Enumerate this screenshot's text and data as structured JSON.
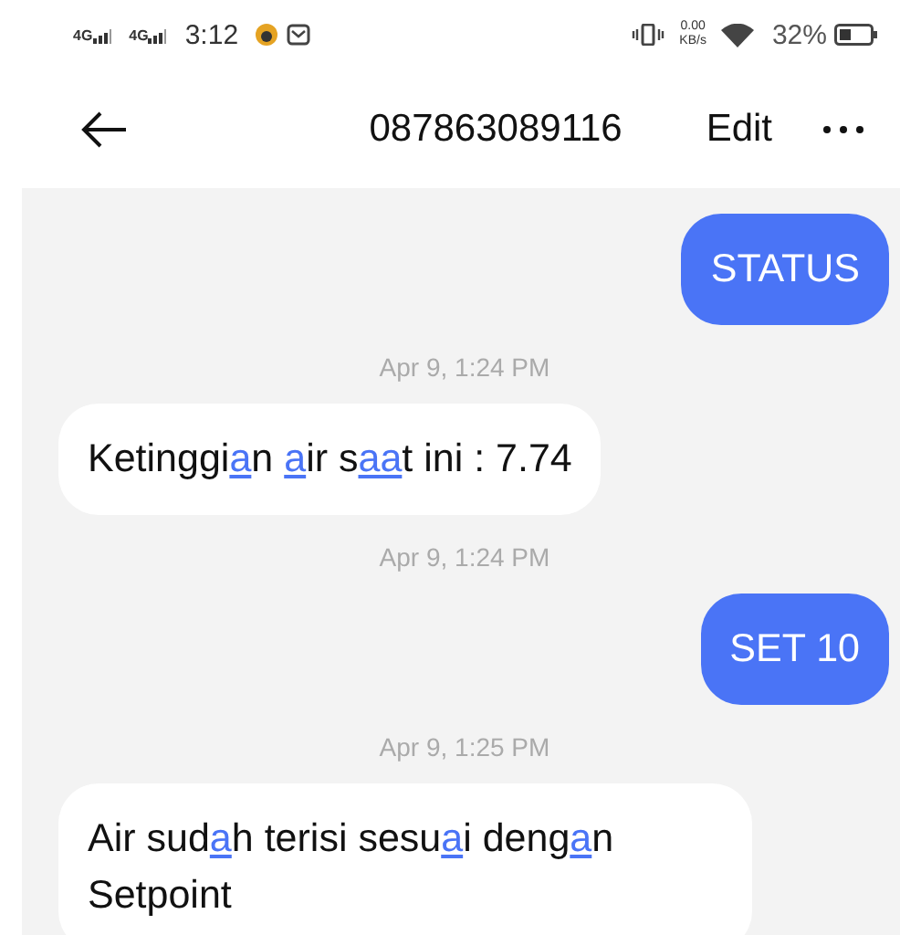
{
  "status_bar": {
    "networks": [
      "4G",
      "4G"
    ],
    "time": "3:12",
    "speed": "0.00",
    "speed_unit": "KB/s",
    "battery": "32%"
  },
  "header": {
    "title": "087863089116",
    "edit": "Edit"
  },
  "messages": [
    {
      "kind": "sent",
      "parts": [
        {
          "text": "STATUS",
          "underlined": false
        }
      ]
    },
    {
      "kind": "time",
      "text": "Apr 9, 1:24 PM"
    },
    {
      "kind": "received",
      "parts": [
        {
          "text": "Ketinggi",
          "underlined": false
        },
        {
          "text": "a",
          "underlined": true
        },
        {
          "text": "n ",
          "underlined": false
        },
        {
          "text": "a",
          "underlined": true
        },
        {
          "text": "ir s",
          "underlined": false
        },
        {
          "text": "aa",
          "underlined": true
        },
        {
          "text": "t ini : 7.74",
          "underlined": false
        }
      ]
    },
    {
      "kind": "time",
      "text": "Apr 9, 1:24 PM"
    },
    {
      "kind": "sent",
      "parts": [
        {
          "text": "SET 10",
          "underlined": false
        }
      ]
    },
    {
      "kind": "time",
      "text": "Apr 9, 1:25 PM"
    },
    {
      "kind": "received",
      "parts": [
        {
          "text": "Air sud",
          "underlined": false
        },
        {
          "text": "a",
          "underlined": true
        },
        {
          "text": "h terisi sesu",
          "underlined": false
        },
        {
          "text": "a",
          "underlined": true
        },
        {
          "text": "i deng",
          "underlined": false
        },
        {
          "text": "a",
          "underlined": true
        },
        {
          "text": "n Setpoint",
          "underlined": false
        }
      ]
    }
  ]
}
